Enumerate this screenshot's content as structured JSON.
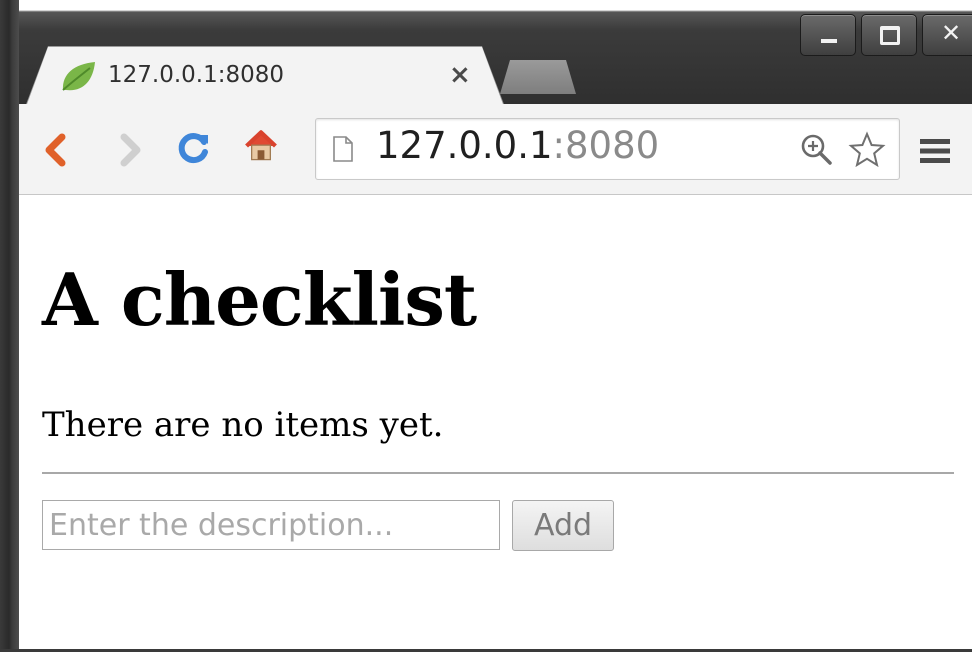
{
  "browser": {
    "tab": {
      "title": "127.0.0.1:8080",
      "close_glyph": "×",
      "favicon": "leaf-icon"
    },
    "new_tab_icon": "new-tab-icon",
    "window_controls": {
      "close_glyph": "✕",
      "minimize_icon": "minimize-icon",
      "maximize_icon": "maximize-icon",
      "close_icon": "close-icon"
    },
    "toolbar": {
      "back_icon": "back-arrow-icon",
      "forward_icon": "forward-arrow-icon",
      "reload_icon": "reload-icon",
      "home_icon": "home-icon",
      "menu_icon": "hamburger-menu-icon"
    },
    "omnibox": {
      "host": "127.0.0.1",
      "port": ":8080",
      "page_icon": "page-icon",
      "zoom_icon": "zoom-icon",
      "bookmark_icon": "star-icon"
    }
  },
  "page": {
    "title": "A checklist",
    "empty_message": "There are no items yet.",
    "form": {
      "description_placeholder": "Enter the description...",
      "description_value": "",
      "add_label": "Add"
    }
  },
  "colors": {
    "frame": "#3a3a3a",
    "toolbar": "#f3f3f3",
    "favicon_green": "#7ab648",
    "back_arrow": "#e0612a",
    "reload_blue": "#3f86d9",
    "home_red": "#d9432e",
    "url_port": "#8a8a8a"
  }
}
